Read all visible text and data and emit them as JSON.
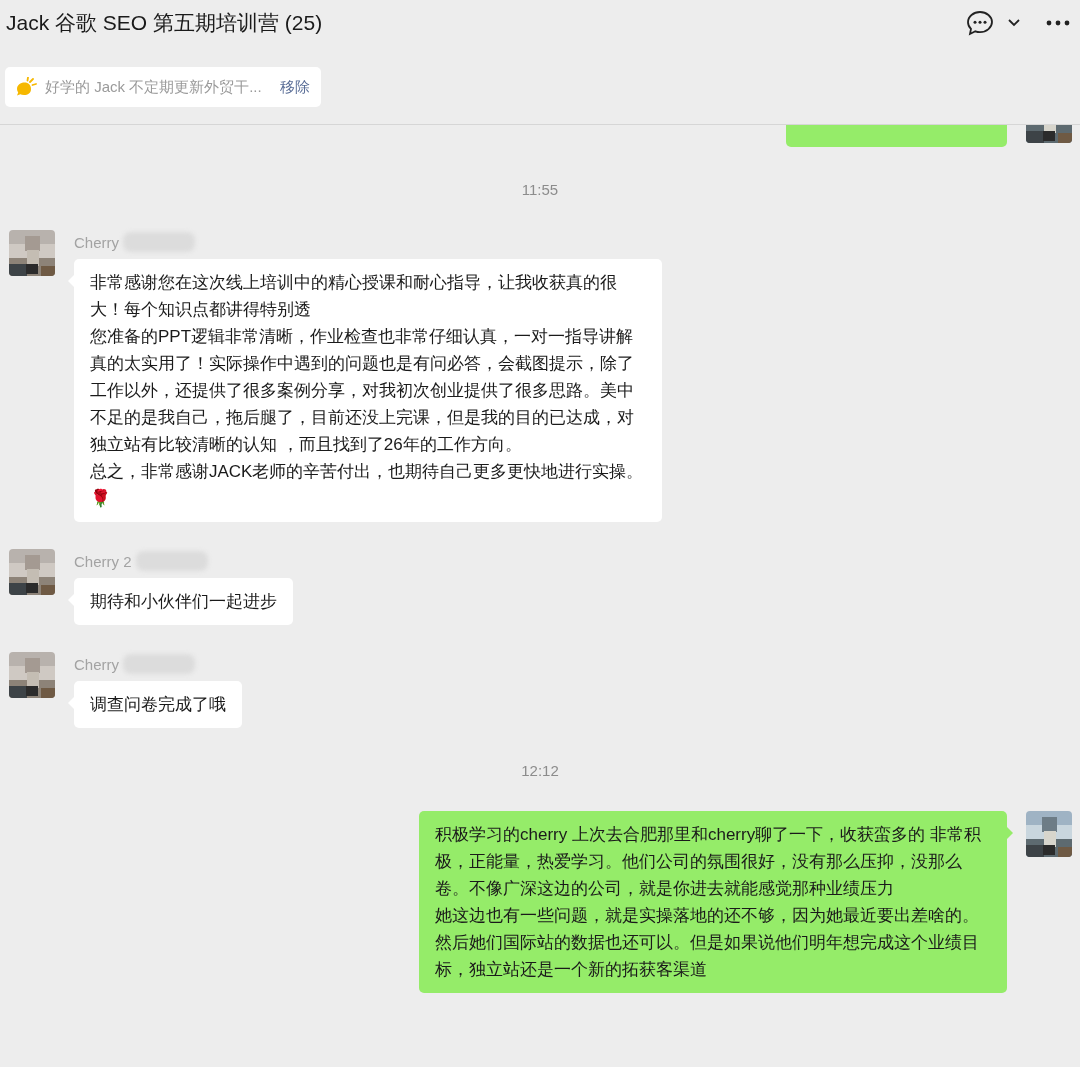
{
  "window": {
    "title": "Jack 谷歌 SEO 第五期培训营 (25)"
  },
  "pinned_notice": {
    "text": "好学的 Jack 不定期更新外贸干...",
    "action": "移除"
  },
  "messages": [
    {
      "kind": "outgoing_cut"
    },
    {
      "kind": "time",
      "text": "11:55"
    },
    {
      "kind": "incoming",
      "sender": "Cherry",
      "paragraphs": [
        "非常感谢您在这次线上培训中的精心授课和耐心指导，让我收获真的很大！每个知识点都讲得特别透",
        "您准备的PPT逻辑非常清晰，作业检查也非常仔细认真，一对一指导讲解真的太实用了！实际操作中遇到的问题也是有问必答，会截图提示，除了工作以外，还提供了很多案例分享，对我初次创业提供了很多思路。美中不足的是我自己，拖后腿了，目前还没上完课，但是我的目的已达成，对独立站有比较清晰的认知 ，而且找到了26年的工作方向。",
        "总之，非常感谢JACK老师的辛苦付出，也期待自己更多更快地进行实操。🌹"
      ]
    },
    {
      "kind": "incoming",
      "sender": "Cherry 2",
      "paragraphs": [
        "期待和小伙伴们一起进步"
      ]
    },
    {
      "kind": "incoming",
      "sender": "Cherry",
      "paragraphs": [
        "调查问卷完成了哦"
      ]
    },
    {
      "kind": "time",
      "text": "12:12"
    },
    {
      "kind": "outgoing",
      "paragraphs": [
        "积极学习的cherry 上次去合肥那里和cherry聊了一下，收获蛮多的 非常积极，正能量，热爱学习。他们公司的氛围很好，没有那么压抑，没那么卷。不像广深这边的公司，就是你进去就能感觉那种业绩压力",
        "她这边也有一些问题，就是实操落地的还不够，因为她最近要出差啥的。然后她们国际站的数据也还可以。但是如果说他们明年想完成这个业绩目标，独立站还是一个新的拓获客渠道"
      ]
    }
  ]
}
